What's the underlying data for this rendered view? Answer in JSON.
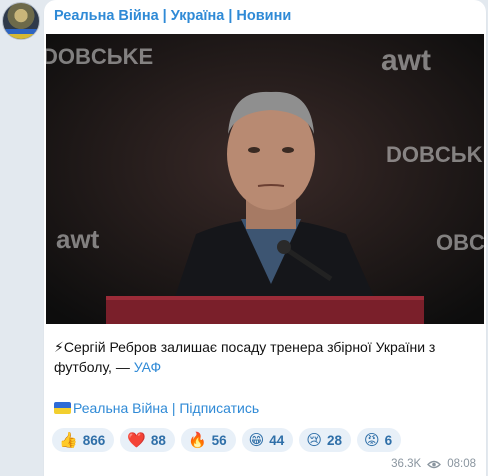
{
  "channel": {
    "title": "Реальна Війна | Україна | Новини"
  },
  "post": {
    "text_before": "Сергій Ребров залишає посаду тренера збірної України з футболу, — ",
    "source_link": "УАФ",
    "subscribe_line": "Реальна Війна | Підписатись",
    "icons": {
      "lead": "lightning-icon",
      "flag": "ukraine-flag-icon"
    }
  },
  "reactions": [
    {
      "emoji": "👍",
      "icon": "thumbs-up-icon",
      "count": "866"
    },
    {
      "emoji": "❤️",
      "icon": "heart-icon",
      "count": "88"
    },
    {
      "emoji": "🔥",
      "icon": "fire-icon",
      "count": "56"
    },
    {
      "emoji": "😁",
      "icon": "grin-icon",
      "count": "44"
    },
    {
      "emoji": "😢",
      "icon": "cry-icon",
      "count": "28"
    },
    {
      "emoji": "😡",
      "icon": "angry-icon",
      "count": "6"
    }
  ],
  "meta": {
    "views": "36.3K",
    "time": "08:08"
  },
  "colors": {
    "accent": "#2f8ad6",
    "chat_bg": "#e3e9ef",
    "reaction_bg": "#e8f0f8"
  }
}
